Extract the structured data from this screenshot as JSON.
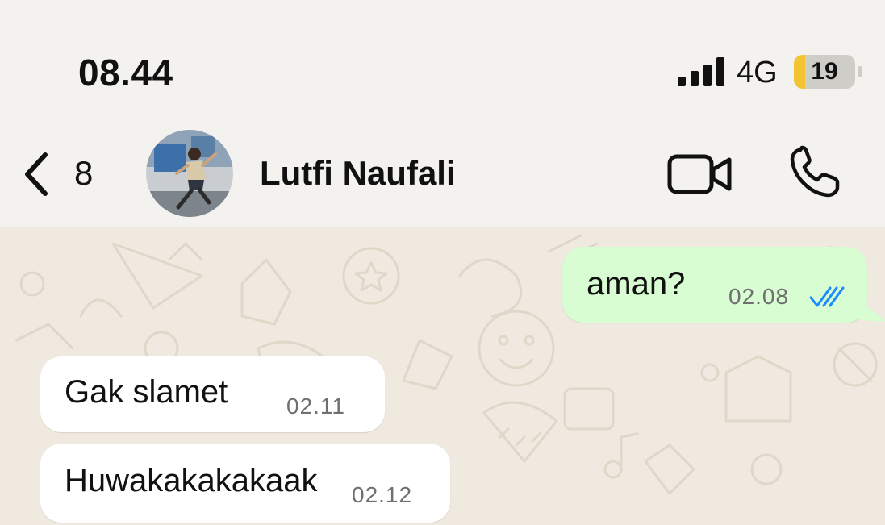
{
  "status_bar": {
    "time": "08.44",
    "network": "4G",
    "battery_level": "19",
    "battery_fraction": 0.19,
    "icons": [
      "signal-bars-icon",
      "battery-icon"
    ]
  },
  "header": {
    "unread_count": "8",
    "contact_name": "Lutfi Naufali",
    "icons": [
      "back-chevron-icon",
      "avatar",
      "video-camera-icon",
      "phone-icon"
    ]
  },
  "messages": [
    {
      "direction": "outgoing",
      "text": "aman?",
      "time": "02.08",
      "status": "read"
    },
    {
      "direction": "incoming",
      "text": "Gak slamet",
      "time": "02.11"
    },
    {
      "direction": "incoming",
      "text": "Huwakakakakaak",
      "time": "02.12"
    }
  ],
  "colors": {
    "outgoing_bubble": "#d9fdd3",
    "incoming_bubble": "#ffffff",
    "read_receipt": "#1a8cff",
    "battery_fill": "#f4c430",
    "chat_background": "#efe9e0"
  }
}
